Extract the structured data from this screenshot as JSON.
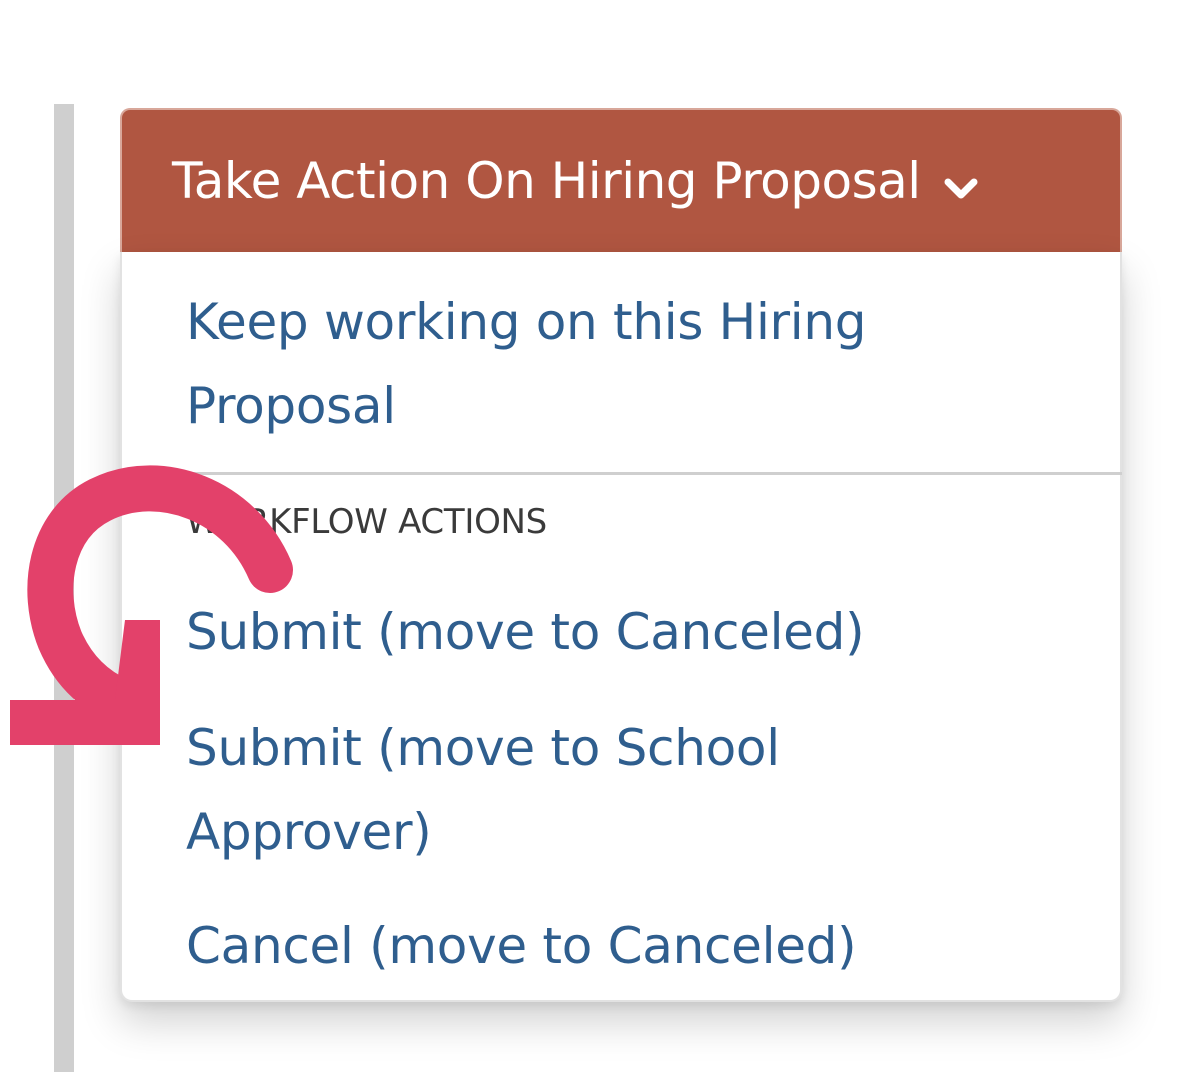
{
  "dropdown": {
    "button_label": "Take Action On Hiring Proposal",
    "button_color": "#b05641",
    "chevron_icon": "chevron-down-icon",
    "items": {
      "keep_working": "Keep working on this Hiring Proposal",
      "section_header": "WORKFLOW ACTIONS",
      "submit_canceled": "Submit (move to Canceled)",
      "submit_school": "Submit (move to School Approver)",
      "cancel": "Cancel (move to Canceled)"
    },
    "link_color": "#2f5e8e"
  },
  "annotation": {
    "arrow_icon": "curved-arrow-icon",
    "arrow_color": "#e3416a"
  }
}
